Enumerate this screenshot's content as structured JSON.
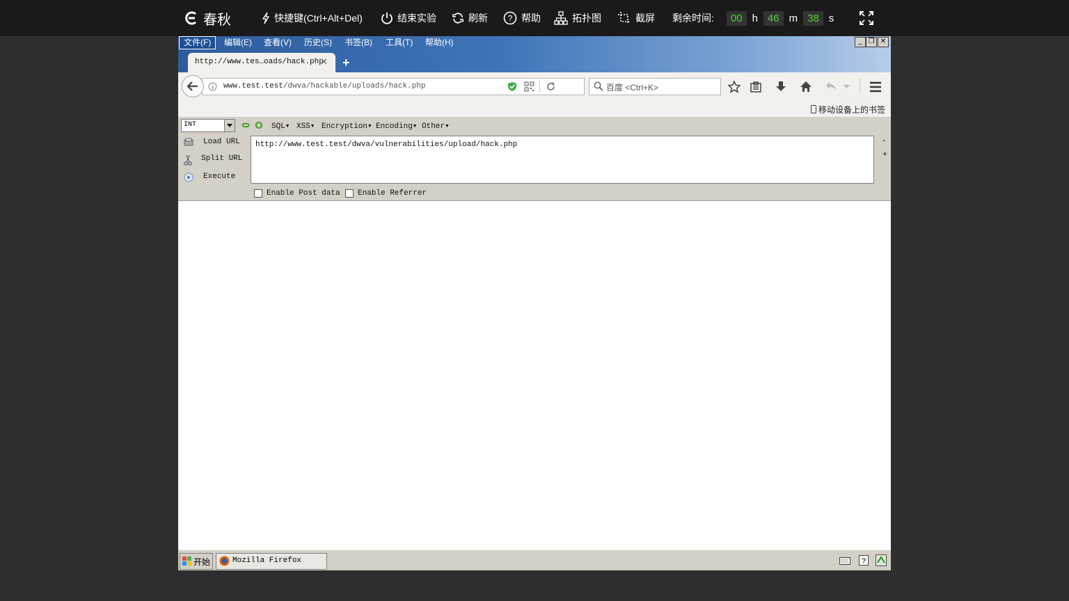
{
  "topbar": {
    "logo_text": "春秋",
    "shortcut": "快捷键(Ctrl+Alt+Del)",
    "end_experiment": "结束实验",
    "refresh": "刷新",
    "help": "帮助",
    "topology": "拓扑图",
    "screenshot": "截屏",
    "remaining_label": "剩余时间:",
    "hours": "00",
    "h_unit": "h",
    "minutes": "46",
    "m_unit": "m",
    "seconds": "38",
    "s_unit": "s"
  },
  "menu": {
    "file": "文件(F)",
    "edit": "编辑(E)",
    "view": "查看(V)",
    "history": "历史(S)",
    "bookmarks": "书签(B)",
    "tools": "工具(T)",
    "help": "帮助(H)"
  },
  "tab": {
    "title": "http://www.tes…oads/hack.php"
  },
  "navbar": {
    "url_domain": "www.test.test",
    "url_path": "/dwva/hackable/uploads/hack.php",
    "search_placeholder": "百度 <Ctrl+K>"
  },
  "bookmarks_bar": {
    "mobile_bookmarks": "移动设备上的书签"
  },
  "hackbar": {
    "select_value": "INT",
    "menus": [
      "SQL▾",
      "XSS▾",
      "Encryption▾",
      "Encoding▾",
      "Other▾"
    ],
    "load_url": "Load URL",
    "split_url": "Split URL",
    "execute": "Execute",
    "url_value": "http://www.test.test/dwva/vulnerabilities/upload/hack.php",
    "enable_post": "Enable Post data",
    "enable_referrer": "Enable Referrer"
  },
  "taskbar": {
    "start": "开始",
    "firefox": "Mozilla Firefox"
  },
  "colors": {
    "timer": "#4cd137",
    "topbar_bg": "#1a1a1a"
  }
}
